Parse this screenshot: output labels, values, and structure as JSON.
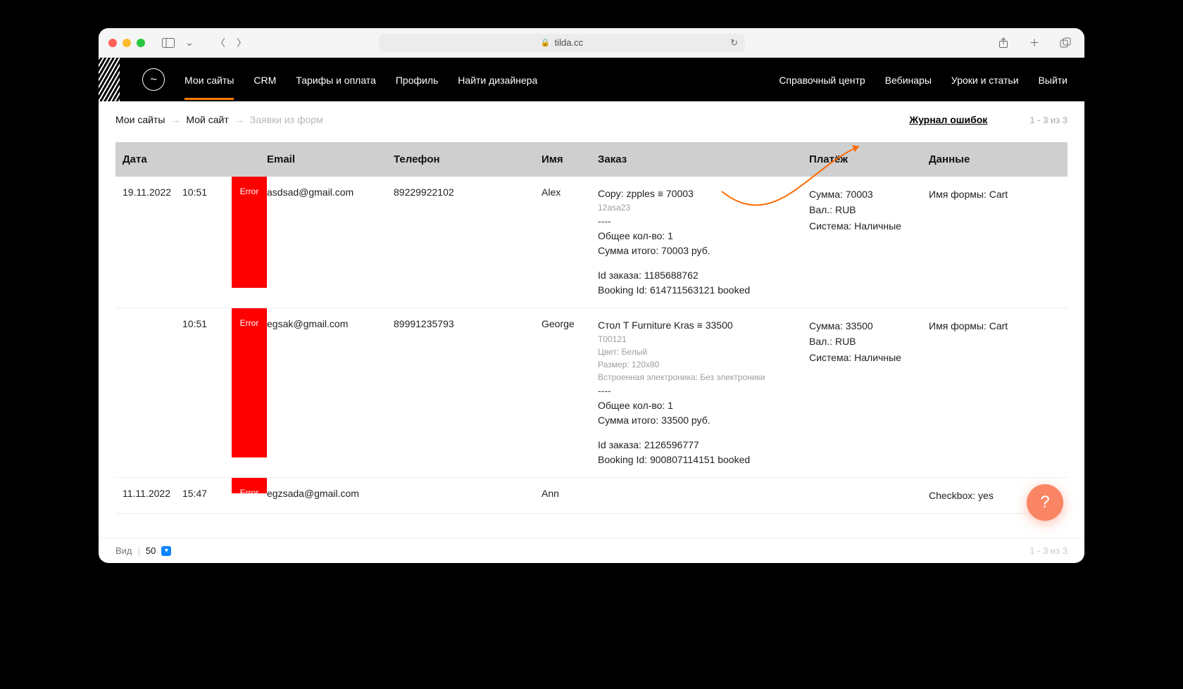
{
  "browser": {
    "url_host": "tilda.cc"
  },
  "nav": {
    "items_left": [
      "Мои сайты",
      "CRM",
      "Тарифы и оплата",
      "Профиль",
      "Найти дизайнера"
    ],
    "items_right": [
      "Справочный центр",
      "Вебинары",
      "Уроки и статьи",
      "Выйти"
    ],
    "active_index": 0
  },
  "crumbs": {
    "a": "Мои сайты",
    "b": "Мой сайт",
    "c": "Заявки из форм"
  },
  "top_right": {
    "error_log": "Журнал ошибок",
    "range": "1 - 3 из 3"
  },
  "table": {
    "headers": {
      "date": "Дата",
      "email": "Email",
      "phone": "Телефон",
      "name": "Имя",
      "order": "Заказ",
      "payment": "Платёж",
      "data": "Данные"
    },
    "rows": [
      {
        "date": "19.11.2022",
        "time": "10:51",
        "status": "Error",
        "email": "asdsad@gmail.com",
        "phone": "89229922102",
        "name": "Alex",
        "order": {
          "title": "Copy: zpples ≡ 70003",
          "sku": "12asa23",
          "sep": "----",
          "qty": "Общее кол-во: 1",
          "total": "Сумма итого: 70003 руб.",
          "oid": "Id заказа: 1185688762",
          "bid": "Booking Id: 614711563121 booked"
        },
        "payment": {
          "sum": "Сумма: 70003",
          "cur": "Вал.: RUB",
          "sys": "Система: Наличные"
        },
        "data": "Имя формы: Cart"
      },
      {
        "date": "",
        "time": "10:51",
        "status": "Error",
        "email": "egsak@gmail.com",
        "phone": "89991235793",
        "name": "George",
        "order": {
          "title": "Стол T Furniture Kras ≡ 33500",
          "sku": "T00121",
          "opt1": "Цвет: Белый",
          "opt2": "Размер: 120x80",
          "opt3": "Встроенная электроника: Без электроники",
          "sep": "----",
          "qty": "Общее кол-во: 1",
          "total": "Сумма итого: 33500 руб.",
          "oid": "Id заказа: 2126596777",
          "bid": "Booking Id: 900807114151 booked"
        },
        "payment": {
          "sum": "Сумма: 33500",
          "cur": "Вал.: RUB",
          "sys": "Система: Наличные"
        },
        "data": "Имя формы: Cart"
      },
      {
        "date": "11.11.2022",
        "time": "15:47",
        "status": "Error",
        "email": "egzsada@gmail.com",
        "phone": "",
        "name": "Ann",
        "order": {},
        "payment": {},
        "data": "Checkbox: yes"
      }
    ]
  },
  "footer": {
    "view_label": "Вид",
    "per_page": "50",
    "range": "1 - 3 из 3"
  },
  "help": "?"
}
